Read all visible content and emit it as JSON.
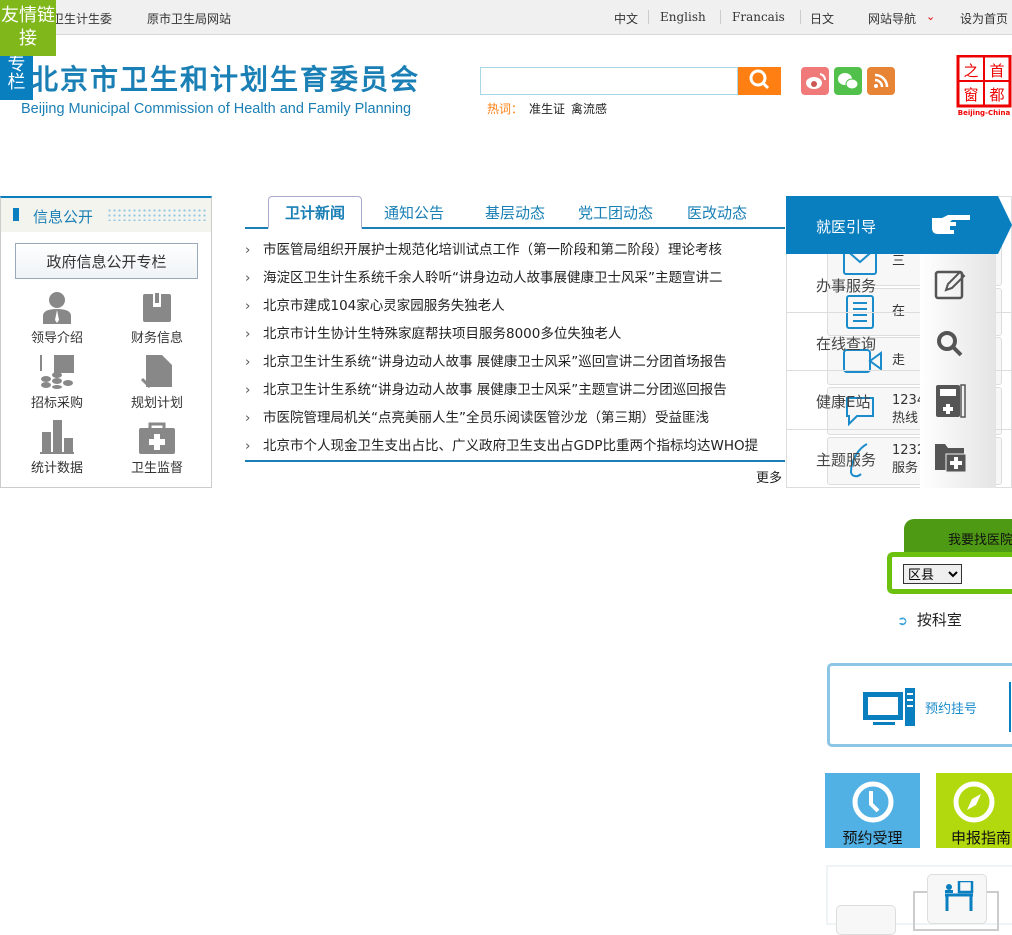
{
  "topbar": {
    "left_links": [
      "卫生计生委",
      "原市卫生局网站"
    ],
    "langs": [
      "中文",
      "English",
      "Francais",
      "日文"
    ],
    "site_nav": "网站导航",
    "set_home": "设为首页"
  },
  "float": {
    "friend_links": "友情链接",
    "column": "专栏"
  },
  "header": {
    "title": "北京市卫生和计划生育委员会",
    "subtitle": "Beijing Municipal Commission of Health and Family Planning",
    "search_placeholder": "",
    "hot_label": "热词：",
    "hot_words": [
      "准生证",
      "禽流感"
    ],
    "logo_text": [
      "之",
      "首",
      "窗",
      "都"
    ],
    "logo_caption": "Beijing-China"
  },
  "info": {
    "title": "信息公开",
    "button": "政府信息公开专栏",
    "items": [
      "领导介绍",
      "财务信息",
      "招标采购",
      "规划计划",
      "统计数据",
      "卫生监督"
    ]
  },
  "news": {
    "tabs": [
      "卫计新闻",
      "通知公告",
      "基层动态",
      "党工团动态",
      "医改动态"
    ],
    "items": [
      "市医管局组织开展护士规范化培训试点工作（第一阶段和第二阶段）理论考核",
      "海淀区卫生计生系统千余人聆听“讲身边动人故事展健康卫士风采”主题宣讲二",
      "北京市建成104家心灵家园服务失独老人",
      "北京市计生协计生特殊家庭帮扶项目服务8000多位失独老人",
      "北京卫生计生系统“讲身边动人故事 展健康卫士风采”巡回宣讲二分团首场报告",
      "北京卫生计生系统“讲身边动人故事 展健康卫士风采”主题宣讲二分团巡回报告",
      "市医院管理局机关“点亮美丽人生”全员乐阅读医管沙龙（第三期）受益匪浅",
      "北京市个人现金卫生支出占比、广义政府卫生支出占GDP比重两个指标均达WHO提"
    ],
    "more": "更多"
  },
  "services": {
    "head": "就医引导",
    "labels": [
      "办事服务",
      "在线查询",
      "健康E站",
      "主题服务"
    ],
    "cards": [
      [
        "三"
      ],
      [
        "在"
      ],
      [
        "走"
      ],
      [
        "1234",
        "热线"
      ],
      [
        "1232",
        "服务"
      ]
    ]
  },
  "hospital": {
    "tab": "我要找医院",
    "district": "区县",
    "by_dept": "按科室"
  },
  "appointment": {
    "label": "预约挂号"
  },
  "tiles": [
    {
      "label": "预约受理",
      "color": "#52b1e4"
    },
    {
      "label": "申报指南",
      "color": "#b2d80e"
    }
  ],
  "colors": {
    "brand": "#0a7fc0",
    "orange": "#ff7f12",
    "green": "#6cc00e"
  }
}
